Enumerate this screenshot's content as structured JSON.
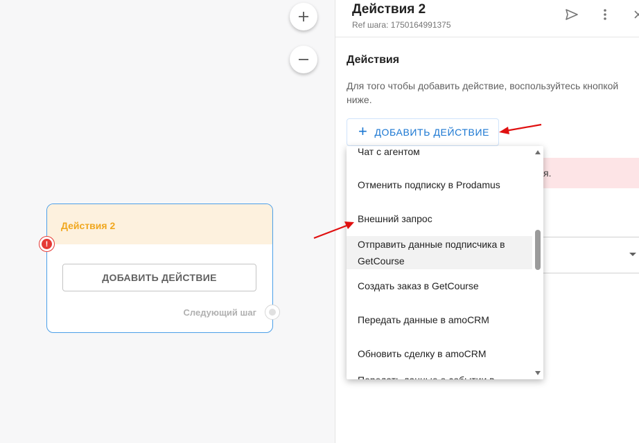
{
  "canvas": {
    "zoom_in_icon": "plus-icon",
    "zoom_out_icon": "minus-icon",
    "node": {
      "title": "Действия 2",
      "add_button": "ДОБАВИТЬ ДЕЙСТВИЕ",
      "next_step_label": "Следующий шаг",
      "error_glyph": "!"
    }
  },
  "panel": {
    "title": "Действия 2",
    "ref": "Ref шага: 1750164991375",
    "section_title": "Действия",
    "description": "Для того чтобы добавить действие, воспользуйтесь кнопкой ниже.",
    "add_button_icon": "+",
    "add_button_label": "ДОБАВИТЬ ДЕЙСТВИЕ",
    "error_text": "я."
  },
  "dropdown": {
    "items": [
      "Чат с агентом",
      "Отменить подписку в Prodamus",
      "Внешний запрос",
      "Отправить данные подписчика в GetCourse",
      "Создать заказ в GetCourse",
      "Передать данные в amoCRM",
      "Обновить сделку в amoCRM",
      "Передать данные о событии в"
    ]
  },
  "colors": {
    "accent_blue": "#1976d2",
    "node_title": "#f0a71e",
    "error_red": "#e53935",
    "annotation_arrow": "#e01010"
  }
}
